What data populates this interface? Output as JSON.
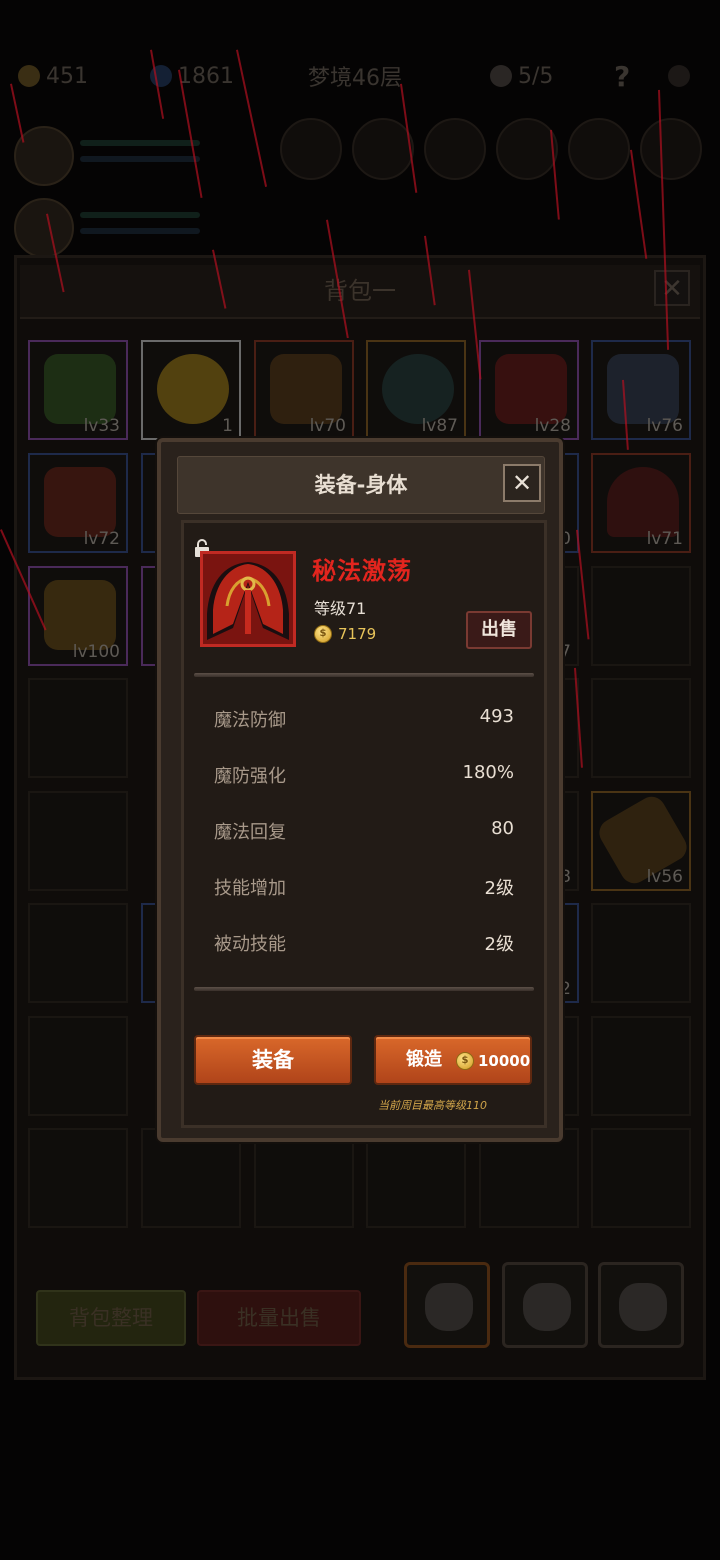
{
  "background": {
    "topbar": {
      "gems": "451",
      "crystals": "1861",
      "floor": "梦境46层",
      "skulls": "5/5",
      "help": "?"
    },
    "bag_title": "背包一",
    "close_glyph": "✕",
    "cells": [
      {
        "lv": "lv33",
        "color": "#3a6a2a",
        "rarity": "#5a2a6a"
      },
      {
        "lv": "1",
        "color": "#c9a020",
        "rarity": "#9a9a9a"
      },
      {
        "lv": "lv70",
        "color": "#6a4a20",
        "rarity": "#6a2a1a"
      },
      {
        "lv": "lv87",
        "color": "#2a4a4a",
        "rarity": "#6a4a1a"
      },
      {
        "lv": "lv28",
        "color": "#7a1a1a",
        "rarity": "#5a2a6a"
      },
      {
        "lv": "lv76",
        "color": "#3a4a6a",
        "rarity": "#2a3a6a"
      },
      {
        "lv": "lv72",
        "color": "#7a2a1a",
        "rarity": "#2a3a6a"
      },
      {
        "lv": "lv71",
        "color": "#6a1a1a",
        "rarity": "#6a2a1a"
      },
      {
        "lv": "lv100",
        "color": "#7a5a20",
        "rarity": "#5a2a6a"
      },
      {
        "lv": "lv56",
        "color": "#6a4a20",
        "rarity": "#6a3a1a"
      }
    ],
    "partial_labels": {
      "r2": "0",
      "r3": "7",
      "r5": "8",
      "r6": "2"
    },
    "sort_button": "背包整理",
    "bulk_sell_button": "批量出售"
  },
  "modal": {
    "title": "装备-身体",
    "close_glyph": "✕",
    "item_name": "秘法激荡",
    "item_level": "等级71",
    "sell_price": "7179",
    "sell_button": "出售",
    "stats": [
      {
        "name": "魔法防御",
        "value": "493"
      },
      {
        "name": "魔防强化",
        "value": "180%"
      },
      {
        "name": "魔法回复",
        "value": "80"
      },
      {
        "name": "技能增加",
        "value": "2级"
      },
      {
        "name": "被动技能",
        "value": "2级"
      }
    ],
    "equip_button": "装备",
    "forge_button": "锻造",
    "forge_cost": "10000",
    "cap_note": "当前周目最高等级110"
  },
  "colors": {
    "item_name": "#e2251e",
    "button_orange": "#d9682a",
    "gold": "#e8c45a"
  }
}
